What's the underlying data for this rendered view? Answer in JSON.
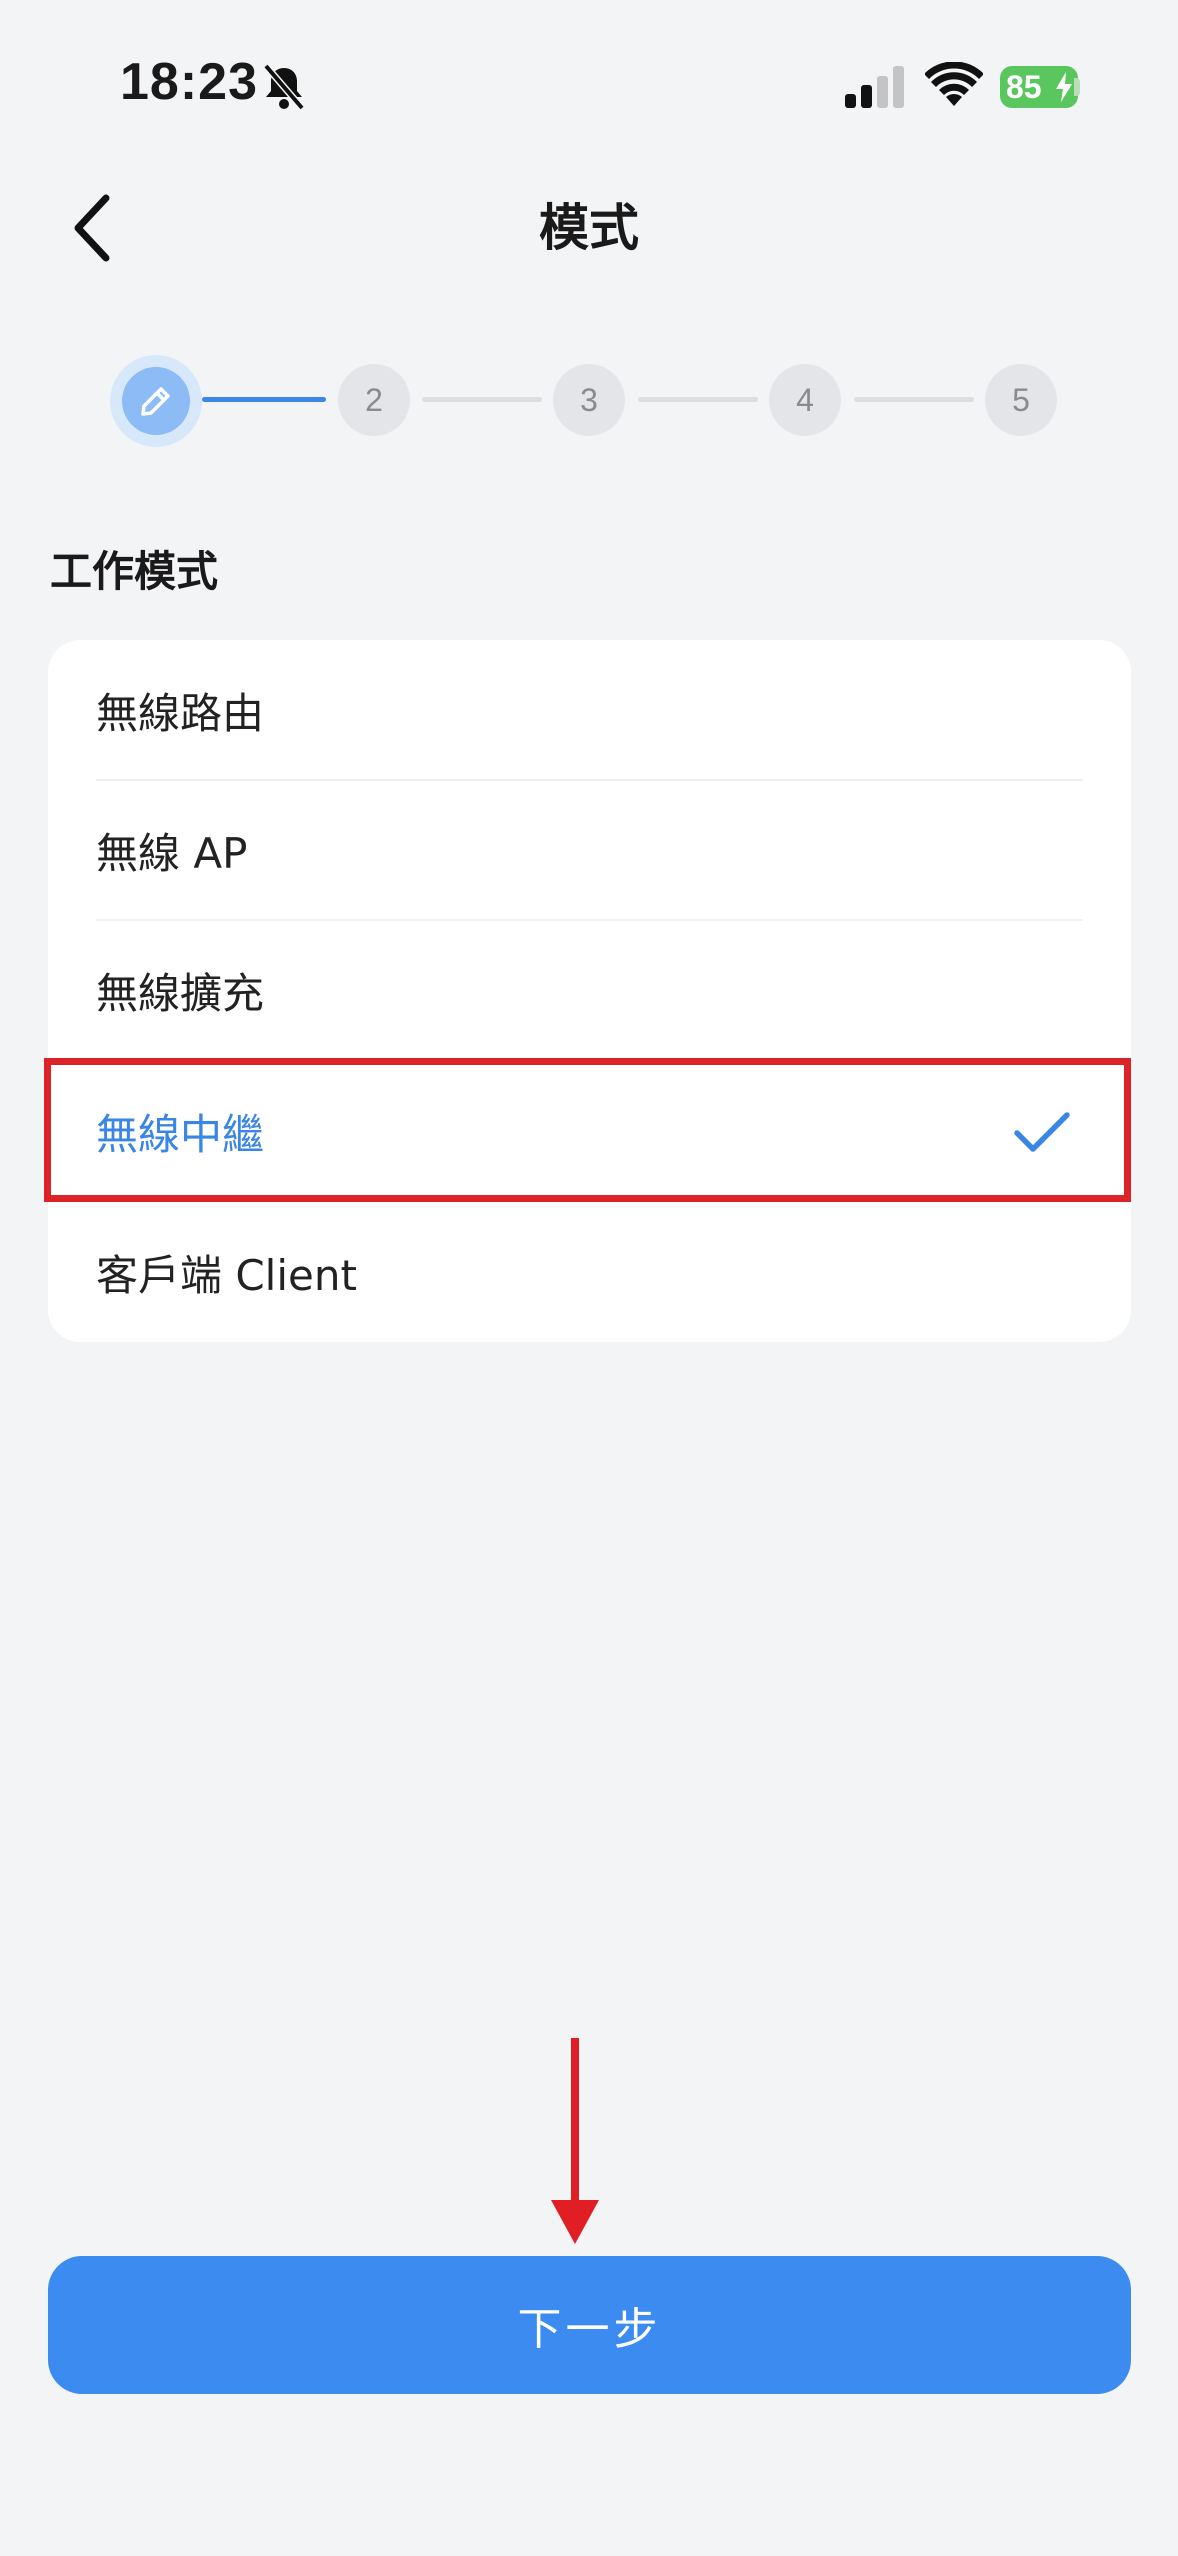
{
  "status_bar": {
    "time": "18:23",
    "battery": "85",
    "icons": [
      "bell-slash-icon",
      "cellular-signal-icon",
      "wifi-icon",
      "battery-charging-icon"
    ]
  },
  "header": {
    "title": "模式",
    "back_icon": "chevron-left-icon"
  },
  "stepper": {
    "active_icon": "pencil-icon",
    "steps": [
      "2",
      "3",
      "4",
      "5"
    ]
  },
  "section": {
    "label": "工作模式"
  },
  "options": [
    {
      "label": "無線路由",
      "selected": false
    },
    {
      "label": "無線 AP",
      "selected": false
    },
    {
      "label": "無線擴充",
      "selected": false
    },
    {
      "label": "無線中繼",
      "selected": true
    },
    {
      "label": "客戶端 Client",
      "selected": false
    }
  ],
  "footer": {
    "next_label": "下一步"
  },
  "colors": {
    "accent": "#3c8bf0",
    "selected_text": "#3a86e6",
    "annotation_red": "#dc2428",
    "battery_green": "#5ac75e"
  }
}
